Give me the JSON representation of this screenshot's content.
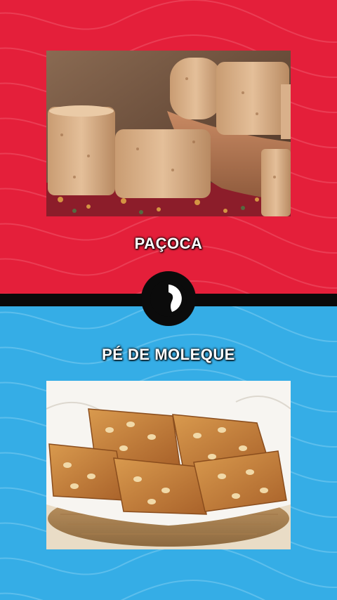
{
  "top": {
    "label": "PAÇOCA",
    "color": "#e41f3a",
    "image": "pacoca-photo"
  },
  "bottom": {
    "label": "PÉ DE MOLEQUE",
    "color": "#35ade6",
    "image": "pe-de-moleque-photo"
  },
  "timer": {
    "icon": "countdown-timer-icon",
    "color": "#0b0b0b"
  }
}
